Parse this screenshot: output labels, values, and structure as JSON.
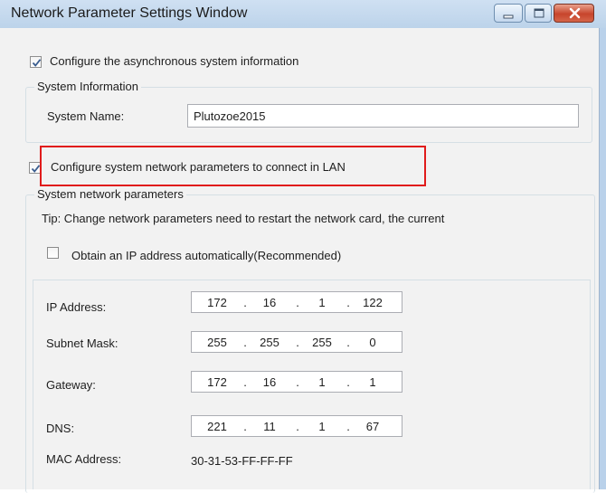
{
  "window": {
    "title": "Network Parameter Settings Window"
  },
  "async_config": {
    "checkbox_label": "Configure the asynchronous system information",
    "checked": true
  },
  "system_information": {
    "legend": "System Information",
    "name_label": "System Name:",
    "name_value": "Plutozoe2015"
  },
  "lan_config": {
    "checkbox_label": "Configure system network parameters to connect in LAN",
    "checked": true
  },
  "network_params": {
    "legend": "System network parameters",
    "tip": "Tip: Change network parameters need to restart the network card, the current",
    "auto_ip_label": "Obtain an IP address automatically(Recommended)",
    "auto_ip_checked": false,
    "ip_label": "IP Address:",
    "ip": [
      "172",
      "16",
      "1",
      "122"
    ],
    "subnet_label": "Subnet Mask:",
    "subnet": [
      "255",
      "255",
      "255",
      "0"
    ],
    "gateway_label": "Gateway:",
    "gateway": [
      "172",
      "16",
      "1",
      "1"
    ],
    "dns_label": "DNS:",
    "dns": [
      "221",
      "11",
      "1",
      "67"
    ],
    "mac_label": "MAC Address:",
    "mac_value": "30-31-53-FF-FF-FF"
  },
  "colors": {
    "highlight_border": "#e01b1b",
    "title_bar": "#bcd3ea",
    "close_button": "#c7452c"
  }
}
